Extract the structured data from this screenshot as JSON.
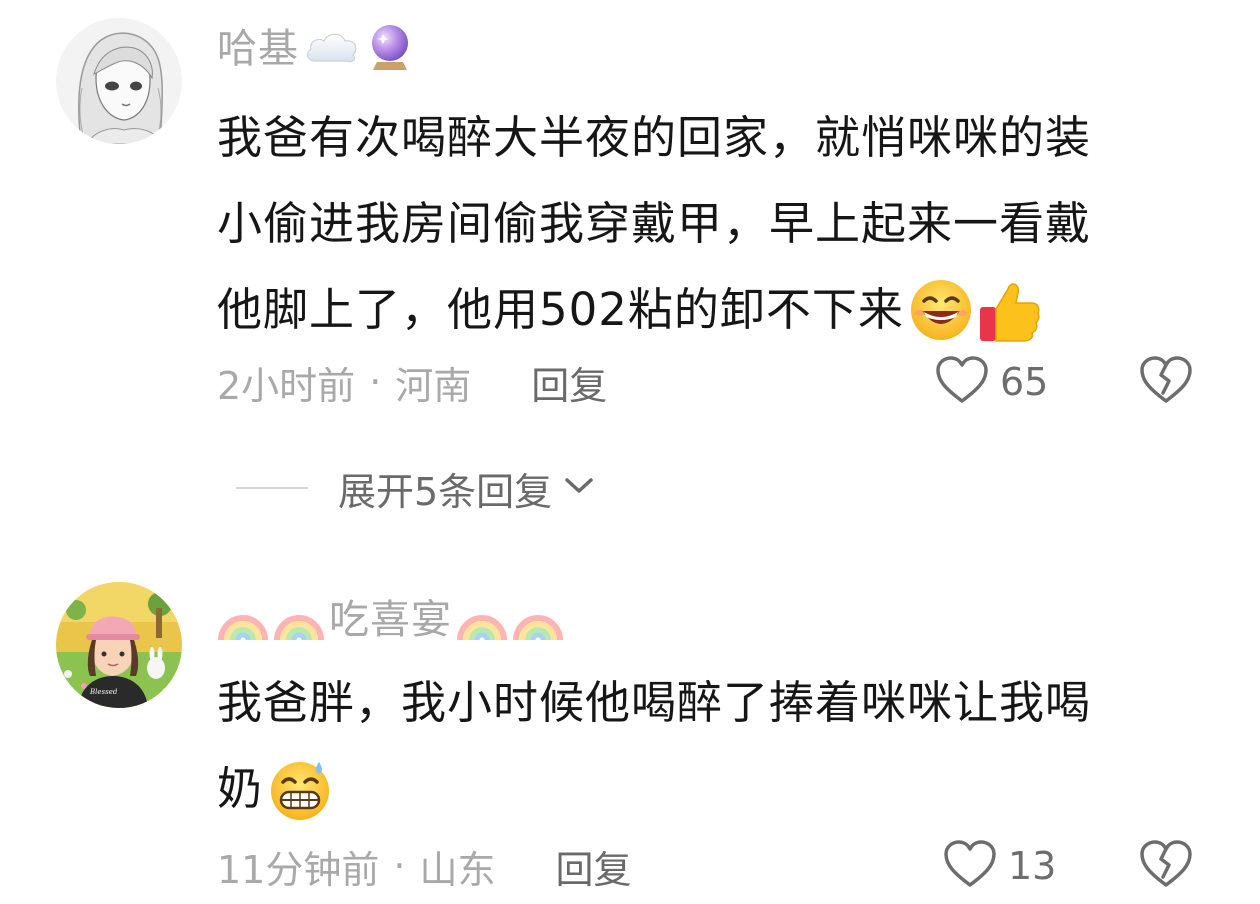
{
  "comments": [
    {
      "username": "哈基",
      "username_emojis": [
        "cloud-icon",
        "crystal-ball-icon"
      ],
      "text_lines": [
        "我爸有次喝醉大半夜的回家，就悄咪咪的装",
        "小偷进我房间偷我穿戴甲，早上起来一看戴",
        "他脚上了，他用502粘的卸不下来"
      ],
      "text_emojis": [
        "grinning-sweat-face-icon",
        "thumbs-up-icon"
      ],
      "time": "2小时前",
      "location": "河南",
      "dot": "·",
      "reply_label": "回复",
      "likes": "65",
      "replies_toggle": {
        "label": "展开5条回复"
      }
    },
    {
      "username": "吃喜宴",
      "username_emojis": [
        "rainbow-icon",
        "rainbow-icon",
        "rainbow-icon",
        "rainbow-icon"
      ],
      "text_lines": [
        "我爸胖，我小时候他喝醉了捧着咪咪让我喝",
        "奶"
      ],
      "text_emojis": [
        "grinning-sweat-face-icon"
      ],
      "time": "11分钟前",
      "location": "山东",
      "dot": "·",
      "reply_label": "回复",
      "likes": "13"
    }
  ],
  "colors": {
    "username": "#a8a8a8",
    "text": "#161616",
    "meta": "#a9a9a9",
    "action": "#6a6a6a"
  }
}
